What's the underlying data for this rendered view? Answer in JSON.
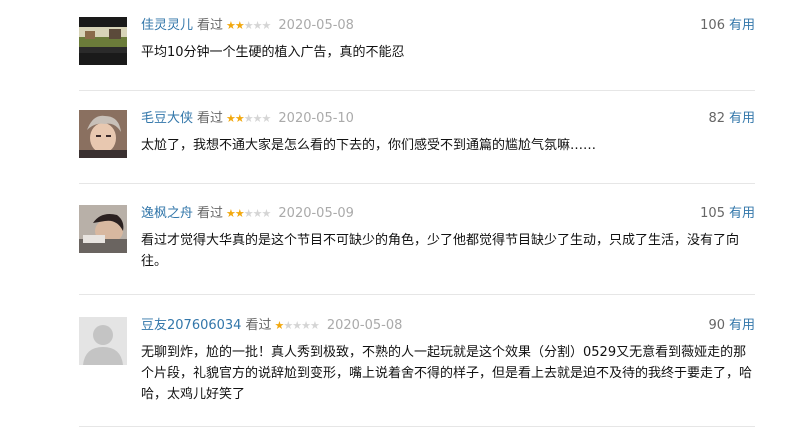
{
  "reviews": [
    {
      "username": "佳灵灵儿",
      "status": "看过",
      "rating": 2,
      "date": "2020-05-08",
      "votes": "106",
      "useful_label": "有用",
      "content": "平均10分钟一个生硬的植入广告，真的不能忍"
    },
    {
      "username": "毛豆大侠",
      "status": "看过",
      "rating": 2,
      "date": "2020-05-10",
      "votes": "82",
      "useful_label": "有用",
      "content": "太尬了，我想不通大家是怎么看的下去的，你们感受不到通篇的尴尬气氛嘛……"
    },
    {
      "username": "逸枫之舟",
      "status": "看过",
      "rating": 2,
      "date": "2020-05-09",
      "votes": "105",
      "useful_label": "有用",
      "content": "看过才觉得大华真的是这个节目不可缺少的角色，少了他都觉得节目缺少了生动，只成了生活，没有了向往。"
    },
    {
      "username": "豆友207606034",
      "status": "看过",
      "rating": 1,
      "date": "2020-05-08",
      "votes": "90",
      "useful_label": "有用",
      "content": "无聊到炸，尬的一批！真人秀到极致，不熟的人一起玩就是这个效果（分割）0529又无意看到薇娅走的那个片段，礼貌官方的说辞尬到变形，嘴上说着舍不得的样子，但是看上去就是迫不及待的我终于要走了，哈哈，太鸡儿好笑了"
    }
  ]
}
